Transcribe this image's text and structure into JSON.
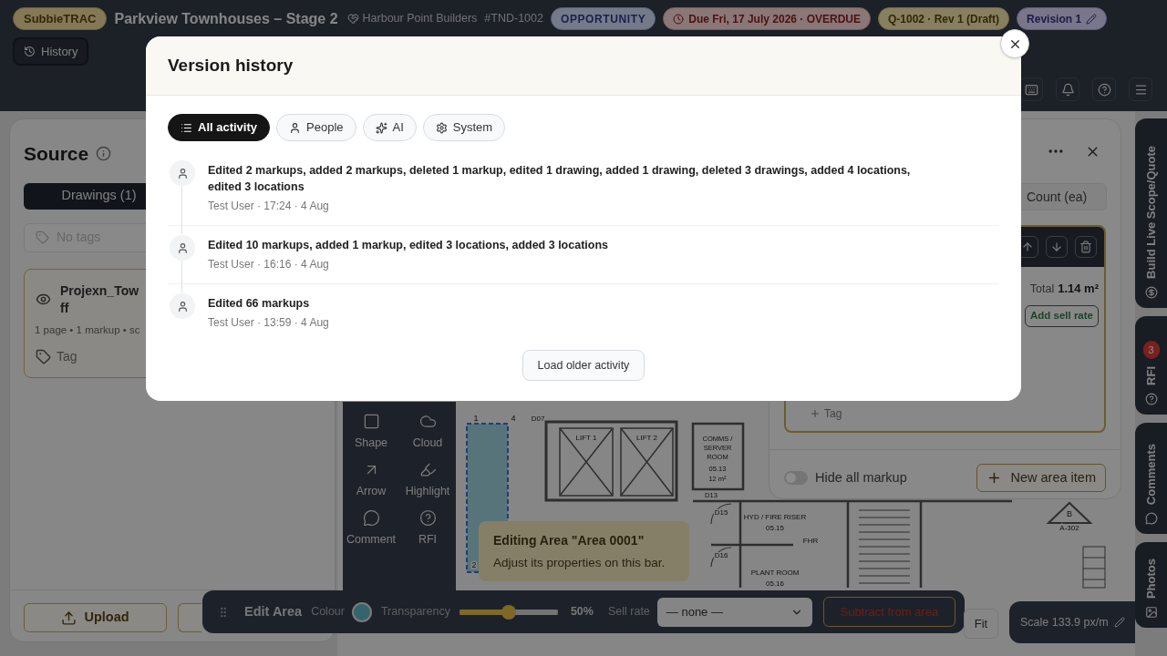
{
  "header": {
    "brand": "SubbieTRAC",
    "project_title": "Parkview Townhouses – Stage 2",
    "client": "Harbour Point Builders",
    "tender_ref": "#TND-1002",
    "badges": [
      {
        "kind": "status",
        "text": "OPPORTUNITY"
      },
      {
        "kind": "due",
        "text": "Due Fri, 17 July 2026 · OVERDUE"
      },
      {
        "kind": "quote",
        "text": "Q-1002 · Rev 1 (Draft)"
      },
      {
        "kind": "revision",
        "text": "Revision 1"
      }
    ],
    "history_button": "History"
  },
  "source_panel": {
    "title": "Source",
    "tabs": [
      {
        "label": "Drawings (1)",
        "selected": true
      }
    ],
    "tags_placeholder": "No tags",
    "drawing": {
      "name_lines": [
        "Projexn_Tow",
        "ff"
      ],
      "meta": "1 page • 1 markup • sc",
      "tag": "Tag"
    },
    "upload_button": "Upload"
  },
  "tools": [
    {
      "kind": "shape",
      "label": "Shape"
    },
    {
      "kind": "cloud",
      "label": "Cloud"
    },
    {
      "kind": "arrow",
      "label": "Arrow"
    },
    {
      "kind": "highlight",
      "label": "Highlight"
    },
    {
      "kind": "comment",
      "label": "Comment"
    },
    {
      "kind": "rfi",
      "label": "RFI"
    }
  ],
  "plan_labels": [
    "D07",
    "LIFT 1",
    "LIFT 2",
    "COMMS /",
    "SERVER",
    "ROOM",
    "05.13",
    "12 m²",
    "D13",
    "D15",
    "HYD / FIRE RISER",
    "05.15",
    "D16",
    "PLANT ROOM",
    "05.16",
    "FHR",
    "B",
    "A-302",
    "1",
    "2",
    "4"
  ],
  "tooltip": {
    "title": "Editing Area \"Area 0001\"",
    "body": "Adjust its properties on this bar."
  },
  "item_panel": {
    "unit": "Count (ea)",
    "total_label": "Total",
    "total_value": "1.14 m²",
    "sell_rate_button": "Add sell rate",
    "tag_button": "Tag",
    "hide_markup": {
      "label": "Hide all markup",
      "on": false
    },
    "new_item_button": "New area item"
  },
  "side_tabs": [
    {
      "kind": "scope",
      "label": "Build Live Scope/Quote"
    },
    {
      "kind": "rfi",
      "label": "RFI",
      "count": "3"
    },
    {
      "kind": "comments",
      "label": "Comments"
    },
    {
      "kind": "photos",
      "label": "Photos"
    }
  ],
  "edit_bar": {
    "title": "Edit Area",
    "colour_label": "Colour",
    "transparency_label": "Transparency",
    "transparency": {
      "level": 0.5
    },
    "transparency_reading": "50%",
    "sell_rate_label": "Sell rate",
    "sell_rate_value": "— none —",
    "subtract_button": "Subtract from area"
  },
  "fit_button": "Fit",
  "scale": "Scale 133.9 px/m",
  "modal": {
    "title": "Version history",
    "filters": [
      {
        "kind": "all",
        "label": "All activity",
        "selected": true
      },
      {
        "kind": "people",
        "label": "People",
        "selected": false
      },
      {
        "kind": "ai",
        "label": "AI",
        "selected": false
      },
      {
        "kind": "system",
        "label": "System",
        "selected": false
      }
    ],
    "activity": [
      {
        "summary": "Edited 2 markups, added 2 markups, deleted 1 markup, edited 1 drawing, added 1 drawing, deleted 3 drawings, added 4 locations, edited 3 locations",
        "meta": "Test User · 17:24 · 4 Aug"
      },
      {
        "summary": "Edited 10 markups, added 1 markup, edited 3 locations, added 3 locations",
        "meta": "Test User · 16:16 · 4 Aug"
      },
      {
        "summary": "Edited 66 markups",
        "meta": "Test User · 13:59 · 4 Aug"
      }
    ],
    "load_more_button": "Load older activity"
  }
}
